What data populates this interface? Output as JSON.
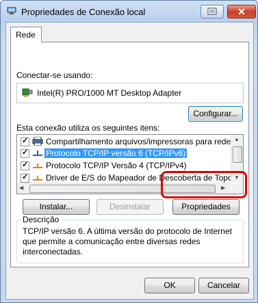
{
  "window": {
    "title": "Propriedades de Conexão local",
    "close_glyph": "✕",
    "help_glyph": "?"
  },
  "tabs": [
    {
      "label": "Rede",
      "selected": true
    }
  ],
  "connect_label": "Conectar-se usando:",
  "adapter": {
    "name": "Intel(R) PRO/1000 MT Desktop Adapter",
    "icon": "network-adapter-icon"
  },
  "configure_button": "Configurar...",
  "items_label": "Esta conexão utiliza os seguintes itens:",
  "items": [
    {
      "label": "Compartilhamento arquivos/impressoras para redes Mic",
      "checked": true,
      "icon": "printer-share-icon",
      "selected": false
    },
    {
      "label": "Protocolo TCP/IP versão 6 (TCP/IPv6)",
      "checked": true,
      "icon": "protocol-icon",
      "selected": true
    },
    {
      "label": "Protocolo TCP/IP Versão 4 (TCP/IPv4)",
      "checked": true,
      "icon": "protocol-icon",
      "selected": false
    },
    {
      "label": "Driver de E/S do Mapeador de Descoberta de Topolog",
      "checked": true,
      "icon": "protocol-icon",
      "selected": false
    }
  ],
  "check_glyph": "✓",
  "buttons": {
    "install": "Instalar...",
    "uninstall": "Desinstalar",
    "properties": "Propriedades",
    "ok": "OK",
    "cancel": "Cancelar"
  },
  "description": {
    "title": "Descrição",
    "text": "TCP/IP versão 6. A última versão do protocolo de Internet que permite a comunicação entre diversas redes interconectadas."
  },
  "colors": {
    "highlight": "#e00000",
    "selection": "#3399ff"
  }
}
